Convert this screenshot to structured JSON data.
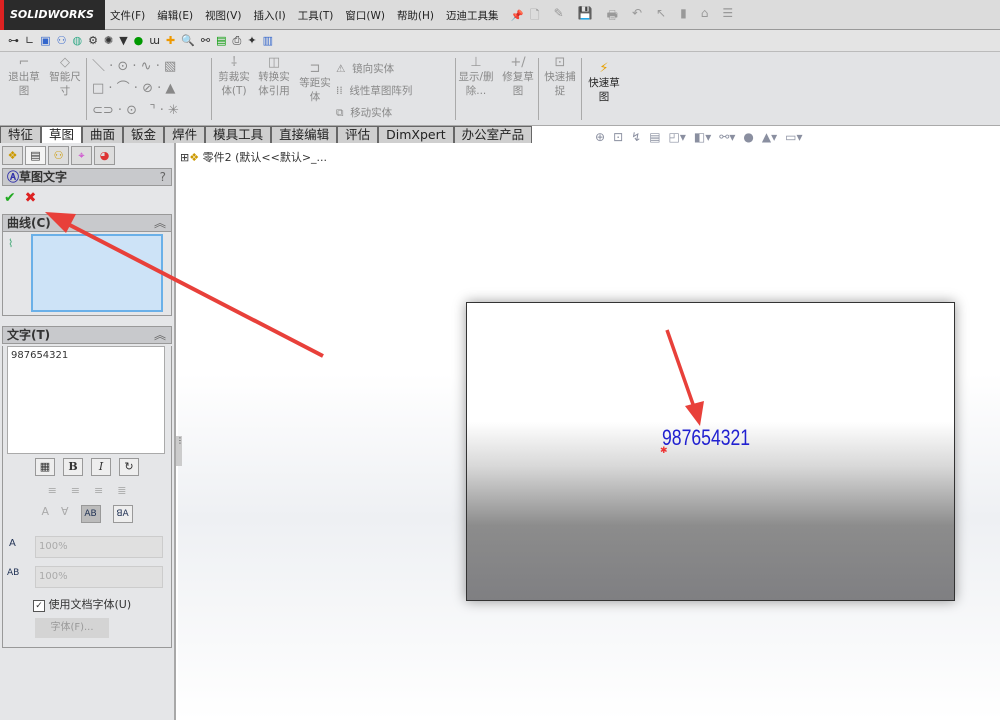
{
  "app": {
    "logo": "SOLIDWORKS"
  },
  "menu": [
    "文件(F)",
    "编辑(E)",
    "视图(V)",
    "插入(I)",
    "工具(T)",
    "窗口(W)",
    "帮助(H)",
    "迈迪工具集"
  ],
  "command": {
    "exit_sketch": "退出草图",
    "smart_dim": "智能尺寸",
    "trim": "剪裁实体(T)",
    "convert": "转换实体引用",
    "offset": "等距实体",
    "mirror": "镜向实体",
    "linear_pattern": "线性草图阵列",
    "move": "移动实体",
    "show_delete": "显示/删除...",
    "repair": "修复草图",
    "quick_snap": "快速捕捉",
    "rapid_sketch": "快速草图"
  },
  "tabs": [
    "特征",
    "草图",
    "曲面",
    "钣金",
    "焊件",
    "模具工具",
    "直接编辑",
    "评估",
    "DimXpert",
    "办公室产品"
  ],
  "tree": {
    "part": "零件2 (默认<<默认>_..."
  },
  "panel": {
    "title": "草图文字",
    "help": "?",
    "curves_label": "曲线(C)",
    "text_label": "文字(T)",
    "text_value": "987654321",
    "width_pct": "100%",
    "spacing_pct": "100%",
    "use_doc_font": "使用文档字体(U)",
    "font_button": "字体(F)..."
  },
  "graphics": {
    "sketch_text": "987654321"
  },
  "colors": {
    "accent_red": "#e8403a",
    "sketch_blue": "#2020d0"
  }
}
